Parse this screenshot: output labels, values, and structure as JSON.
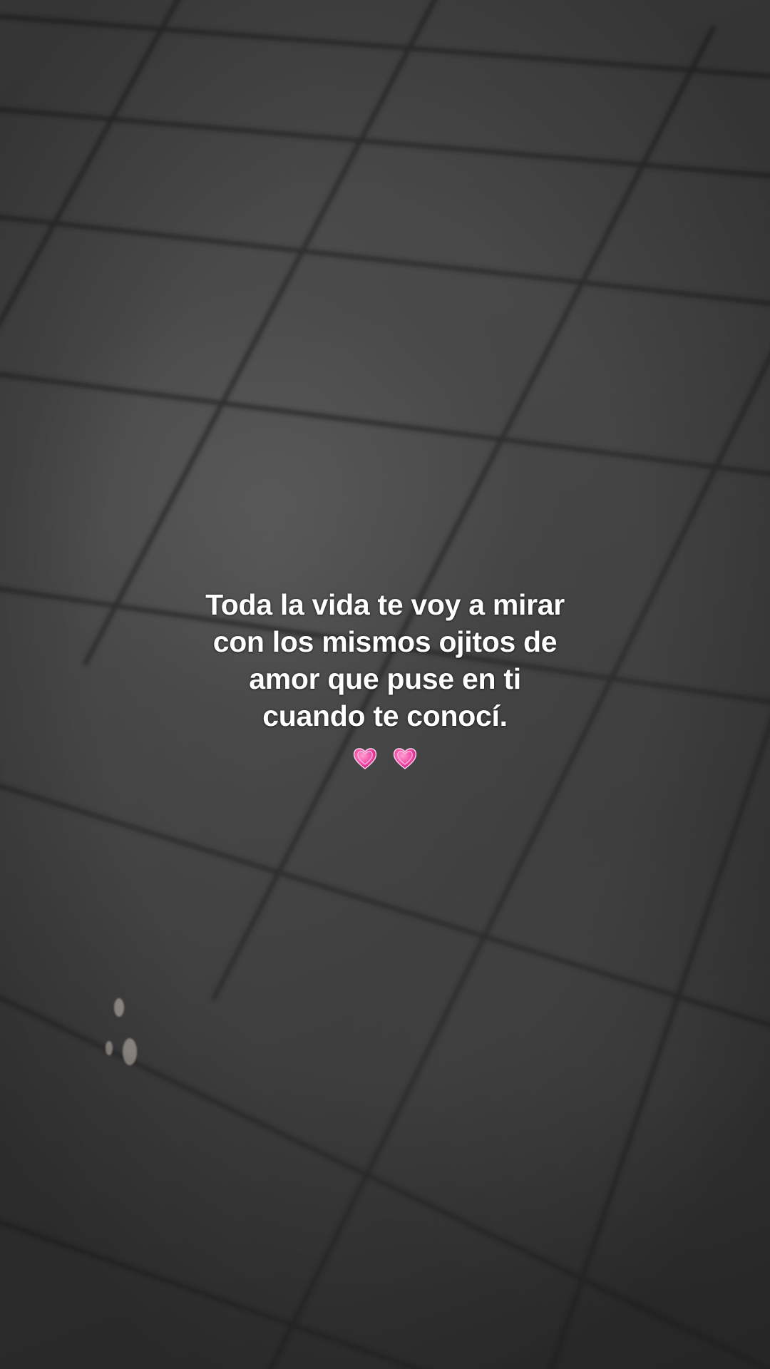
{
  "caption": {
    "lines": [
      "Toda la vida te voy a mirar",
      "con los mismos ojitos de",
      "amor que puse en ti",
      "cuando te conocí."
    ],
    "emoji": "💗💗"
  },
  "colors": {
    "text": "#ffffff",
    "heart": "#e83a9c",
    "tile": "#454545",
    "grout": "#2e2e2e"
  },
  "icons": [
    "beating-heart-icon",
    "beating-heart-icon"
  ]
}
